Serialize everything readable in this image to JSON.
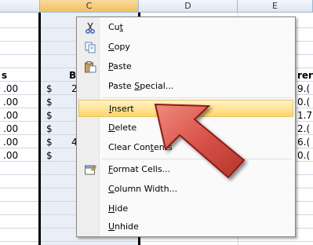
{
  "columns": {
    "c": "C",
    "d": "D",
    "e": "E"
  },
  "cells": {
    "row_header_left": "s",
    "row_header_b": "B",
    "row_header_right": "rer",
    "left_values": [
      ".00",
      ".00",
      ".00",
      ".00",
      ".00",
      ".00"
    ],
    "dollar_values": [
      "$",
      "$",
      "$",
      "$",
      "$",
      "$"
    ],
    "b_digits": [
      "2",
      "",
      "",
      "",
      "4",
      ""
    ],
    "right_values": [
      "9.(",
      "0.(",
      "1.7",
      "2.(",
      "6.(",
      "0.("
    ]
  },
  "context_menu": {
    "items": [
      {
        "label": "Cut",
        "mnemonic_index": 2,
        "icon": "scissors-icon"
      },
      {
        "label": "Copy",
        "mnemonic_index": 0,
        "icon": "copy-icon"
      },
      {
        "label": "Paste",
        "mnemonic_index": 0,
        "icon": "paste-icon"
      },
      {
        "label": "Paste Special...",
        "mnemonic_index": 6,
        "icon": ""
      },
      {
        "label": "Insert",
        "mnemonic_index": 0,
        "icon": "",
        "highlighted": true
      },
      {
        "label": "Delete",
        "mnemonic_index": 0,
        "icon": ""
      },
      {
        "label": "Clear Contents",
        "mnemonic_index": 9,
        "icon": ""
      },
      {
        "label": "Format Cells...",
        "mnemonic_index": 0,
        "icon": "format-cells-icon"
      },
      {
        "label": "Column Width...",
        "mnemonic_index": 0,
        "icon": ""
      },
      {
        "label": "Hide",
        "mnemonic_index": 0,
        "icon": ""
      },
      {
        "label": "Unhide",
        "mnemonic_index": 0,
        "icon": ""
      }
    ]
  },
  "colors": {
    "highlight_top": "#fff3c8",
    "highlight_bottom": "#ffd56a",
    "arrow_fill": "#d9534a",
    "arrow_stroke": "#8c1f16"
  }
}
